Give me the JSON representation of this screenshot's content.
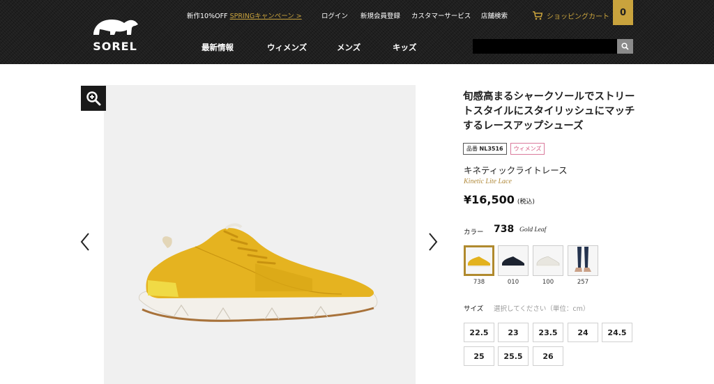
{
  "brand": {
    "logo_text": "SOREL"
  },
  "header": {
    "promo_text": "新作10%OFF",
    "promo_link": "SPRINGキャンペーン >",
    "login": "ログイン",
    "register": "新規会員登録",
    "customer_service": "カスタマーサービス",
    "store_search": "店舗検索",
    "cart_label": "ショッピングカート",
    "cart_count": "0",
    "search_placeholder": ""
  },
  "nav": {
    "news": "最新情報",
    "women": "ウィメンズ",
    "men": "メンズ",
    "kids": "キッズ"
  },
  "product": {
    "title": "旬感高まるシャークソールでストリートスタイルにスタイリッシュにマッチするレースアップシューズ",
    "code_prefix": "品番",
    "code": "NL3516",
    "category": "ウィメンズ",
    "name_ja": "キネティックライトレース",
    "name_en": "Kinetic Lite Lace",
    "price": "¥16,500",
    "tax_note": "(税込)"
  },
  "color": {
    "label": "カラー",
    "selected_code": "738",
    "selected_name": "Gold Leaf",
    "swatches": [
      {
        "code": "738",
        "color": "#e3b21e"
      },
      {
        "code": "010",
        "color": "#1c2330"
      },
      {
        "code": "100",
        "color": "#e8e6df"
      },
      {
        "code": "257",
        "color": "#c9a087"
      }
    ]
  },
  "size": {
    "label": "サイズ",
    "hint": "選択してください（単位：cm）",
    "options": [
      "22.5",
      "23",
      "23.5",
      "24",
      "24.5",
      "25",
      "25.5",
      "26"
    ]
  },
  "colors": {
    "accent": "#c9a33d",
    "header_bg": "#1f1f1f",
    "badge_pink": "#d4537e"
  }
}
